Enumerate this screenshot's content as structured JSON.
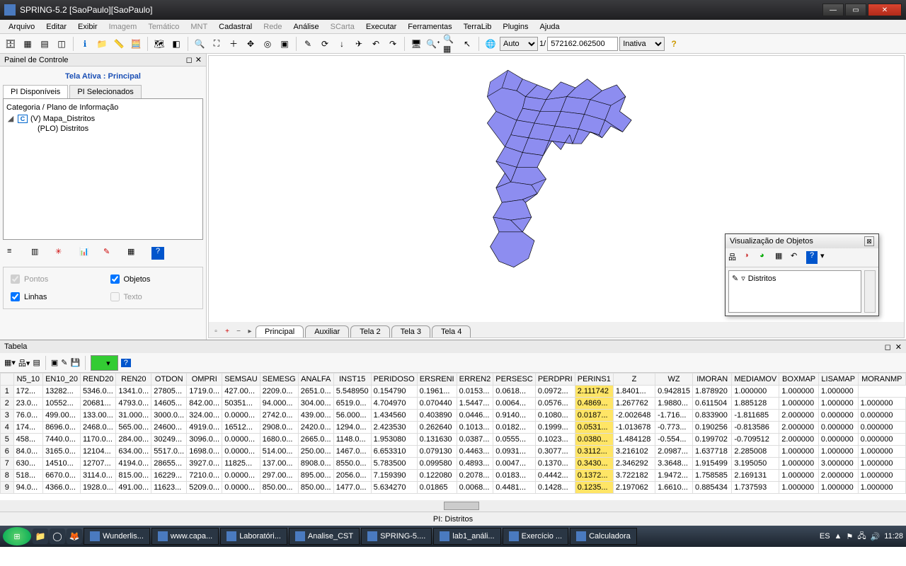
{
  "window": {
    "title": "SPRING-5.2 [SaoPaulo][SaoPaulo]"
  },
  "menu": [
    "Arquivo",
    "Editar",
    "Exibir",
    "Imagem",
    "Temático",
    "MNT",
    "Cadastral",
    "Rede",
    "Análise",
    "SCarta",
    "Executar",
    "Ferramentas",
    "TerraLib",
    "Plugins",
    "Ajuda"
  ],
  "menu_disabled": [
    3,
    4,
    5,
    7,
    9
  ],
  "toolbar": {
    "scale_mode": "Auto",
    "scale_num": "1/",
    "scale_val": "572162.062500",
    "status_sel": "Inativa"
  },
  "panel": {
    "title": "Painel de Controle",
    "active": "Tela Ativa : Principal",
    "tabs": [
      "PI Disponíveis",
      "PI Selecionados"
    ],
    "tree_header": "Categoria / Plano de Informação",
    "items": [
      "(V) Mapa_Distritos",
      "(PLO) Distritos"
    ],
    "checks": {
      "pontos": "Pontos",
      "objetos": "Objetos",
      "linhas": "Linhas",
      "texto": "Texto"
    }
  },
  "map_tabs": [
    "Principal",
    "Auxiliar",
    "Tela 2",
    "Tela 3",
    "Tela 4"
  ],
  "float": {
    "title": "Visualização de Objetos",
    "item": "Distritos"
  },
  "table": {
    "title": "Tabela",
    "columns": [
      "N5_10",
      "EN10_20",
      "REND20",
      "REN20",
      "OTDON",
      "OMPRI",
      "SEMSAU",
      "SEMESG",
      "ANALFA",
      "INST15",
      "PERIDOSO",
      "ERSRENI",
      "ERREN2",
      "PERSESC",
      "PERDPRI",
      "PERINS1",
      "Z",
      "WZ",
      "IMORAN",
      "MEDIAMOV",
      "BOXMAP",
      "LISAMAP",
      "MORANMP"
    ],
    "rows": [
      [
        "172...",
        "13282...",
        "5346.0...",
        "1341.0...",
        "27805...",
        "1719.0...",
        "427.00...",
        "2209.0...",
        "2651.0...",
        "5.548950",
        "0.154790",
        "0.1961...",
        "0.0153...",
        "0.0618...",
        "0.0972...",
        "2.111742",
        "1.8401...",
        "0.942815",
        "1.878920",
        "1.000000",
        "1.000000",
        "1.000000"
      ],
      [
        "23.0...",
        "10552...",
        "20681...",
        "4793.0...",
        "14605...",
        "842.00...",
        "50351...",
        "94.000...",
        "304.00...",
        "6519.0...",
        "4.704970",
        "0.070440",
        "1.5447...",
        "0.0064...",
        "0.0576...",
        "0.4869...",
        "1.267762",
        "1.9880...",
        "0.611504",
        "1.885128",
        "1.000000",
        "1.000000",
        "1.000000"
      ],
      [
        "76.0...",
        "499.00...",
        "133.00...",
        "31.000...",
        "3000.0...",
        "324.00...",
        "0.0000...",
        "2742.0...",
        "439.00...",
        "56.000...",
        "1.434560",
        "0.403890",
        "0.0446...",
        "0.9140...",
        "0.1080...",
        "0.0187...",
        "-2.002648",
        "-1.716...",
        "0.833900",
        "-1.811685",
        "2.000000",
        "0.000000",
        "0.000000"
      ],
      [
        "174...",
        "8696.0...",
        "2468.0...",
        "565.00...",
        "24600...",
        "4919.0...",
        "16512...",
        "2908.0...",
        "2420.0...",
        "1294.0...",
        "2.423530",
        "0.262640",
        "0.1013...",
        "0.0182...",
        "0.1999...",
        "0.0531...",
        "-1.013678",
        "-0.773...",
        "0.190256",
        "-0.813586",
        "2.000000",
        "0.000000",
        "0.000000"
      ],
      [
        "458...",
        "7440.0...",
        "1170.0...",
        "284.00...",
        "30249...",
        "3096.0...",
        "0.0000...",
        "1680.0...",
        "2665.0...",
        "1148.0...",
        "1.953080",
        "0.131630",
        "0.0387...",
        "0.0555...",
        "0.1023...",
        "0.0380...",
        "-1.484128",
        "-0.554...",
        "0.199702",
        "-0.709512",
        "2.000000",
        "0.000000",
        "0.000000"
      ],
      [
        "84.0...",
        "3165.0...",
        "12104...",
        "634.00...",
        "5517.0...",
        "1698.0...",
        "0.0000...",
        "514.00...",
        "250.00...",
        "1467.0...",
        "6.653310",
        "0.079130",
        "0.4463...",
        "0.0931...",
        "0.3077...",
        "0.3112...",
        "3.216102",
        "2.0987...",
        "1.637718",
        "2.285008",
        "1.000000",
        "1.000000",
        "1.000000"
      ],
      [
        "630...",
        "14510...",
        "12707...",
        "4194.0...",
        "28655...",
        "3927.0...",
        "11825...",
        "137.00...",
        "8908.0...",
        "8550.0...",
        "5.783500",
        "0.099580",
        "0.4893...",
        "0.0047...",
        "0.1370...",
        "0.3430...",
        "2.346292",
        "3.3648...",
        "1.915499",
        "3.195050",
        "1.000000",
        "3.000000",
        "1.000000"
      ],
      [
        "518...",
        "6670.0...",
        "3114.0...",
        "815.00...",
        "16229...",
        "7210.0...",
        "0.0000...",
        "297.00...",
        "895.00...",
        "2056.0...",
        "7.159390",
        "0.122080",
        "0.2078...",
        "0.0183...",
        "0.4442...",
        "0.1372...",
        "3.722182",
        "1.9472...",
        "1.758585",
        "2.169131",
        "1.000000",
        "2.000000",
        "1.000000"
      ],
      [
        "94.0...",
        "4366.0...",
        "1928.0...",
        "491.00...",
        "11623...",
        "5209.0...",
        "0.0000...",
        "850.00...",
        "850.00...",
        "1477.0...",
        "5.634270",
        "0.01865",
        "0.0068...",
        "0.4481...",
        "0.1428...",
        "0.1235...",
        "2.197062",
        "1.6610...",
        "0.885434",
        "1.737593",
        "1.000000",
        "1.000000",
        "1.000000"
      ]
    ],
    "highlight_col": 16,
    "pi_status": "PI: Distritos"
  },
  "taskbar": {
    "items": [
      "Wunderlis...",
      "www.capa...",
      "Laboratóri...",
      "Analise_CST",
      "SPRING-5....",
      "lab1_análi...",
      "Exercício ...",
      "Calculadora"
    ],
    "lang": "ES",
    "time": "11:28"
  }
}
